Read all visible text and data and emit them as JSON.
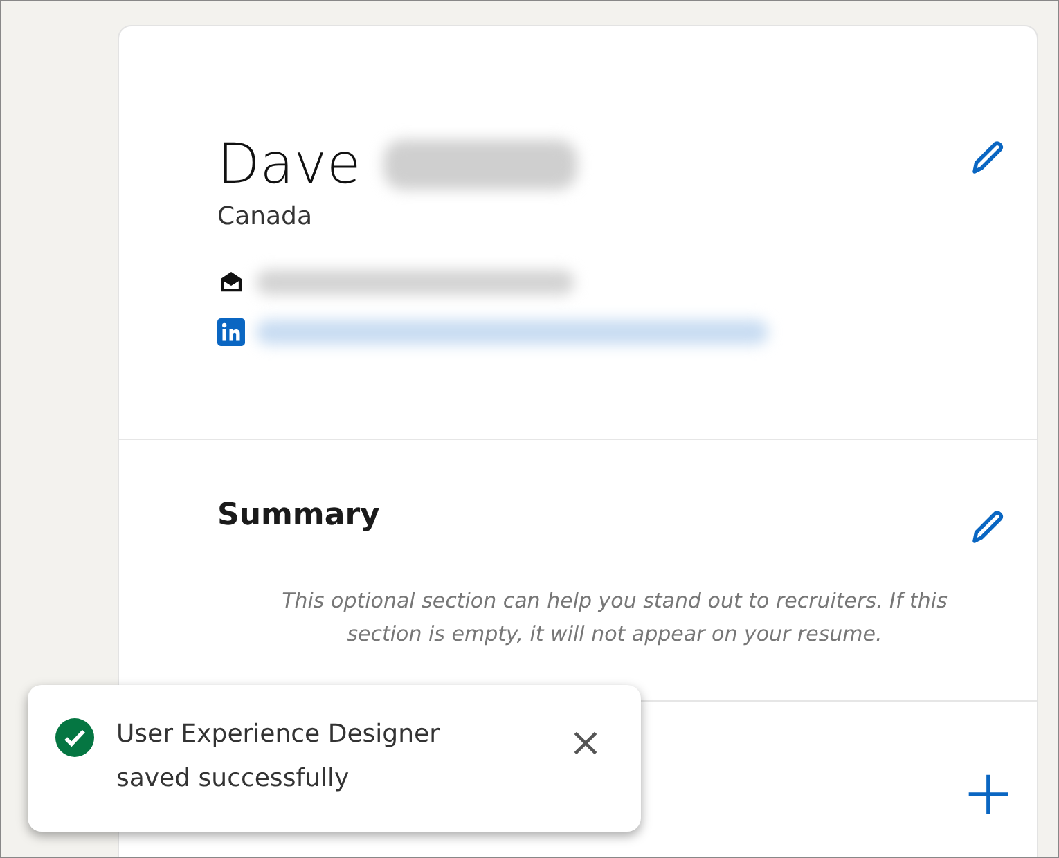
{
  "profile": {
    "name": "Dave",
    "surname_blurred": true,
    "location": "Canada",
    "contacts": [
      {
        "kind": "email"
      },
      {
        "kind": "linkedin"
      }
    ]
  },
  "summary": {
    "title": "Summary",
    "hint": "This optional section can help you stand out to recruiters. If this section is empty, it will not appear on your resume."
  },
  "toast": {
    "message": "User Experience Designer saved successfully"
  }
}
